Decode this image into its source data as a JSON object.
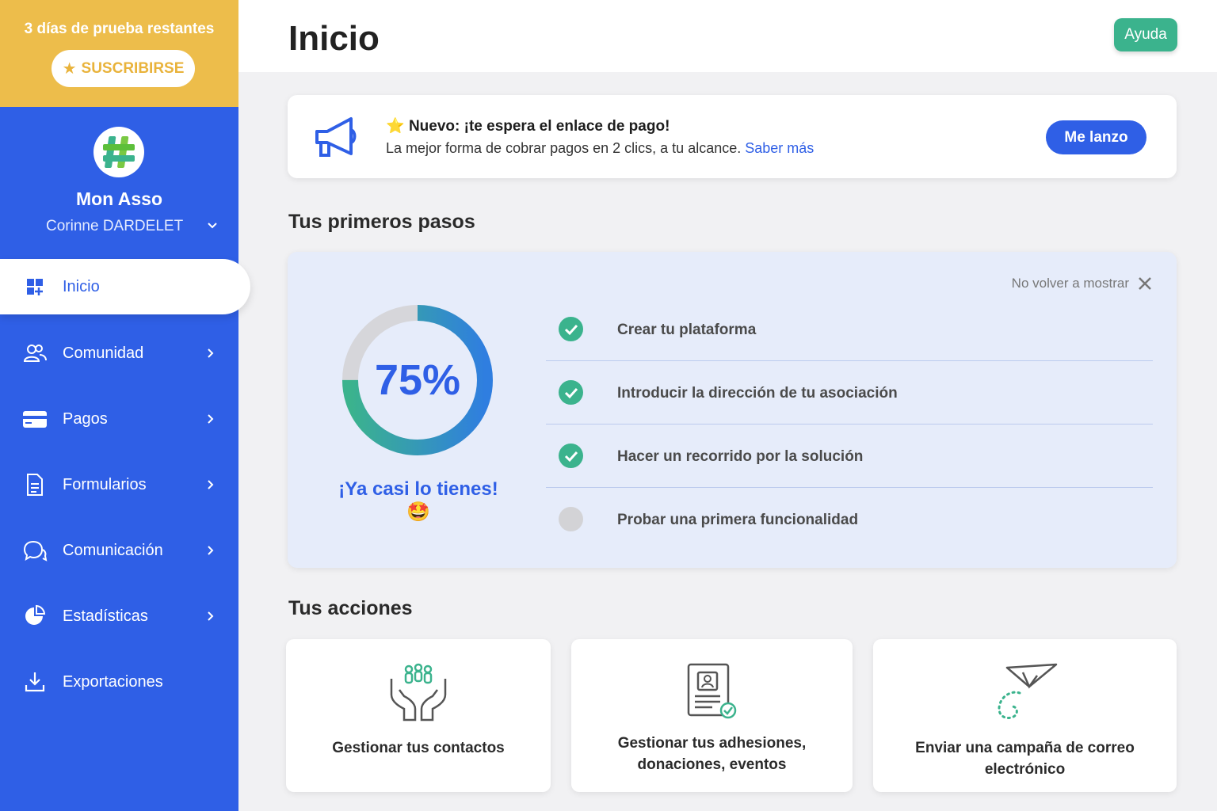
{
  "trial": {
    "text": "3 días de prueba restantes",
    "subscribe_label": "SUSCRIBIRSE"
  },
  "org": {
    "name": "Mon Asso",
    "user": "Corinne DARDELET"
  },
  "nav": [
    {
      "label": "Inicio",
      "icon": "dashboard-icon",
      "active": true
    },
    {
      "label": "Comunidad",
      "icon": "users-icon"
    },
    {
      "label": "Pagos",
      "icon": "credit-card-icon"
    },
    {
      "label": "Formularios",
      "icon": "document-icon"
    },
    {
      "label": "Comunicación",
      "icon": "chat-icon"
    },
    {
      "label": "Estadísticas",
      "icon": "pie-chart-icon"
    },
    {
      "label": "Exportaciones",
      "icon": "download-icon"
    }
  ],
  "header": {
    "title": "Inicio",
    "help_label": "Ayuda"
  },
  "announcement": {
    "title": "Nuevo: ¡te espera el enlace de pago!",
    "body": "La mejor forma de cobrar pagos en 2 clics, a tu alcance.",
    "link": "Saber más",
    "button": "Me lanzo"
  },
  "first_steps": {
    "title": "Tus primeros pasos",
    "dismiss_label": "No volver a mostrar",
    "progress_percent": 75,
    "progress_label": "75%",
    "cheer": "¡Ya casi lo tienes! 🤩",
    "steps": [
      {
        "label": "Crear tu plataforma",
        "done": true
      },
      {
        "label": "Introducir la dirección de tu asociación",
        "done": true
      },
      {
        "label": "Hacer un recorrido por la solución",
        "done": true
      },
      {
        "label": "Probar una primera funcionalidad",
        "done": false
      }
    ]
  },
  "actions": {
    "title": "Tus acciones",
    "cards": [
      {
        "line1": "Gestionar tus contactos",
        "line2": "",
        "icon": "hands-people-icon"
      },
      {
        "line1": "Gestionar tus adhesiones,",
        "line2": "donaciones, eventos",
        "icon": "member-card-icon"
      },
      {
        "line1": "Enviar una campaña de correo electrónico",
        "line2": "",
        "icon": "paper-plane-icon"
      }
    ]
  },
  "colors": {
    "primary": "#2f5fe6",
    "accent_green": "#3bb38d",
    "trial_yellow": "#edbd4b"
  }
}
